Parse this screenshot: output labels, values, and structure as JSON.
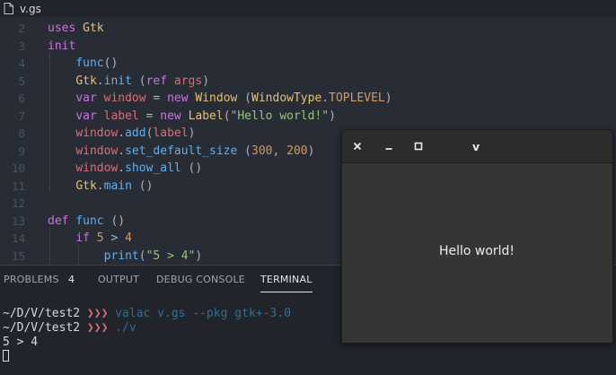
{
  "tab": {
    "title": "v.gs",
    "icon": "file-icon"
  },
  "editor": {
    "lines": [
      {
        "num": "2",
        "segs": [
          [
            "k",
            "uses "
          ],
          [
            "t",
            "Gtk"
          ]
        ]
      },
      {
        "num": "3",
        "segs": [
          [
            "k",
            "init"
          ]
        ]
      },
      {
        "num": "4",
        "segs": [
          [
            "p",
            "    "
          ],
          [
            "f",
            "func"
          ],
          [
            "p",
            "()"
          ]
        ]
      },
      {
        "num": "5",
        "segs": [
          [
            "p",
            "    "
          ],
          [
            "t",
            "Gtk"
          ],
          [
            "p",
            "."
          ],
          [
            "f",
            "init"
          ],
          [
            "p",
            " ("
          ],
          [
            "k",
            "ref"
          ],
          [
            "p",
            " "
          ],
          [
            "v",
            "args"
          ],
          [
            "p",
            ")"
          ]
        ]
      },
      {
        "num": "6",
        "segs": [
          [
            "p",
            "    "
          ],
          [
            "k",
            "var"
          ],
          [
            "p",
            " "
          ],
          [
            "v",
            "window"
          ],
          [
            "p",
            " = "
          ],
          [
            "k",
            "new"
          ],
          [
            "p",
            " "
          ],
          [
            "t",
            "Window"
          ],
          [
            "p",
            " ("
          ],
          [
            "t",
            "WindowType"
          ],
          [
            "p",
            "."
          ],
          [
            "n",
            "TOPLEVEL"
          ],
          [
            "p",
            ")"
          ]
        ]
      },
      {
        "num": "7",
        "segs": [
          [
            "p",
            "    "
          ],
          [
            "k",
            "var"
          ],
          [
            "p",
            " "
          ],
          [
            "v",
            "label"
          ],
          [
            "p",
            " = "
          ],
          [
            "k",
            "new"
          ],
          [
            "p",
            " "
          ],
          [
            "t",
            "Label"
          ],
          [
            "p",
            "("
          ],
          [
            "s",
            "\"Hello world!\""
          ],
          [
            "p",
            ")"
          ]
        ]
      },
      {
        "num": "8",
        "segs": [
          [
            "p",
            "    "
          ],
          [
            "v",
            "window"
          ],
          [
            "p",
            "."
          ],
          [
            "f",
            "add"
          ],
          [
            "p",
            "("
          ],
          [
            "v",
            "label"
          ],
          [
            "p",
            ")"
          ]
        ]
      },
      {
        "num": "9",
        "segs": [
          [
            "p",
            "    "
          ],
          [
            "v",
            "window"
          ],
          [
            "p",
            "."
          ],
          [
            "f",
            "set_default_size"
          ],
          [
            "p",
            " ("
          ],
          [
            "n",
            "300"
          ],
          [
            "p",
            ", "
          ],
          [
            "n",
            "200"
          ],
          [
            "p",
            ")"
          ]
        ]
      },
      {
        "num": "10",
        "segs": [
          [
            "p",
            "    "
          ],
          [
            "v",
            "window"
          ],
          [
            "p",
            "."
          ],
          [
            "f",
            "show_all"
          ],
          [
            "p",
            " ()"
          ]
        ]
      },
      {
        "num": "11",
        "segs": [
          [
            "p",
            "    "
          ],
          [
            "t",
            "Gtk"
          ],
          [
            "p",
            "."
          ],
          [
            "f",
            "main"
          ],
          [
            "p",
            " ()"
          ]
        ]
      },
      {
        "num": "12",
        "segs": []
      },
      {
        "num": "13",
        "segs": [
          [
            "k",
            "def"
          ],
          [
            "p",
            " "
          ],
          [
            "f",
            "func"
          ],
          [
            "p",
            " ()"
          ]
        ]
      },
      {
        "num": "14",
        "segs": [
          [
            "p",
            "    "
          ],
          [
            "k",
            "if"
          ],
          [
            "p",
            " "
          ],
          [
            "n",
            "5"
          ],
          [
            "p",
            " > "
          ],
          [
            "n",
            "4"
          ]
        ]
      },
      {
        "num": "15",
        "segs": [
          [
            "p",
            "        "
          ],
          [
            "f",
            "print"
          ],
          [
            "p",
            "("
          ],
          [
            "s",
            "\"5 > 4\""
          ],
          [
            "p",
            ")"
          ]
        ]
      }
    ]
  },
  "panel": {
    "tabs": [
      {
        "label": "PROBLEMS",
        "active": false
      },
      {
        "label": "OUTPUT",
        "active": false
      },
      {
        "label": "DEBUG CONSOLE",
        "active": false
      },
      {
        "label": "TERMINAL",
        "active": true
      }
    ],
    "problems_count": "4",
    "terminal": {
      "prompt1": "~/D/V/test2",
      "arrows": "❯❯❯",
      "cmd1": "valac v.gs --pkg gtk+-3.0",
      "prompt2": "~/D/V/test2",
      "cmd2": "./v",
      "output": "5 > 4"
    }
  },
  "gtk_window": {
    "title": "v",
    "label": "Hello world!",
    "buttons": [
      "close-icon",
      "minimize-icon",
      "maximize-icon"
    ]
  }
}
